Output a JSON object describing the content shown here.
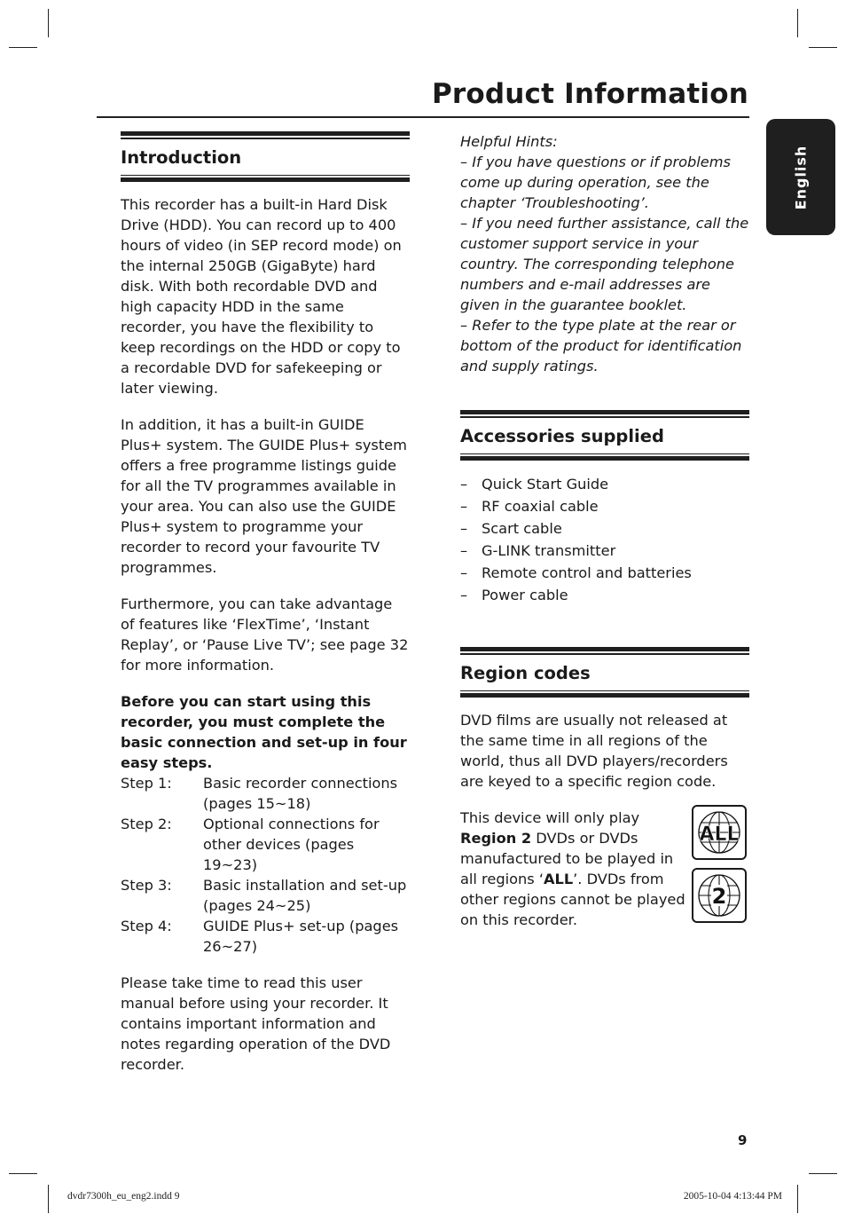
{
  "header": {
    "title": "Product Information",
    "language_tab": "English"
  },
  "introduction": {
    "heading": "Introduction",
    "paragraphs": [
      "This recorder has a built-in Hard Disk Drive (HDD).  You can record up to 400 hours of video (in SEP record mode) on the internal 250GB (GigaByte) hard disk. With both recordable DVD and high capacity HDD in the same recorder, you have the flexibility to keep recordings on the HDD or copy to a recordable DVD for safekeeping or later viewing.",
      "In addition, it has a built-in GUIDE Plus+ system. The GUIDE Plus+ system offers a free programme listings guide for all the TV programmes available in your area. You can also use the GUIDE Plus+ system to programme your recorder to record your favourite TV programmes.",
      "Furthermore, you can take advantage of features like ‘FlexTime’, ‘Instant Replay’, or ‘Pause Live TV’; see page 32 for more information."
    ],
    "bold_notice": "Before you can start using this recorder, you must complete the basic connection and set-up in four easy steps.",
    "steps": [
      {
        "label": "Step 1:",
        "text": "Basic recorder connections (pages 15~18)"
      },
      {
        "label": "Step 2:",
        "text": "Optional connections for other devices (pages 19~23)"
      },
      {
        "label": "Step 3:",
        "text": "Basic installation and set-up (pages 24~25)"
      },
      {
        "label": "Step 4:",
        "text": "GUIDE Plus+ set-up (pages 26~27)"
      }
    ],
    "closing": "Please take time to read this user manual before using your recorder. It contains important information and notes regarding operation of the DVD recorder."
  },
  "hints": {
    "title": "Helpful Hints:",
    "items": [
      "–  If you have questions or if problems come up during operation, see the chapter ‘Troubleshooting’.",
      "–  If you need further assistance, call the customer support service in your country. The corresponding telephone numbers and e-mail addresses are given in the guarantee booklet.",
      "–  Refer to the type plate at the rear or bottom of the product for identification and supply ratings."
    ]
  },
  "accessories": {
    "heading": "Accessories supplied",
    "dash": "–",
    "items": [
      "Quick Start Guide",
      "RF coaxial cable",
      "Scart cable",
      "G-LINK transmitter",
      "Remote control and batteries",
      "Power cable"
    ]
  },
  "region": {
    "heading": "Region codes",
    "intro": "DVD films are usually not released at the same time in all regions of the world, thus all DVD players/recorders are keyed to a specific region code.",
    "text_1": "This device will only play",
    "bold_region": "Region 2",
    "text_2": " DVDs or DVDs manufactured to be played in all regions ‘",
    "bold_all": "ALL",
    "text_3": "’.  DVDs from other regions cannot be played on this recorder.",
    "icons": [
      {
        "name": "region-all-icon",
        "label": "ALL"
      },
      {
        "name": "region-2-icon",
        "label": "2"
      }
    ]
  },
  "footer": {
    "page_number": "9",
    "slug_file": "dvdr7300h_eu_eng2.indd   9",
    "slug_date": "2005-10-04   4:13:44 PM"
  }
}
